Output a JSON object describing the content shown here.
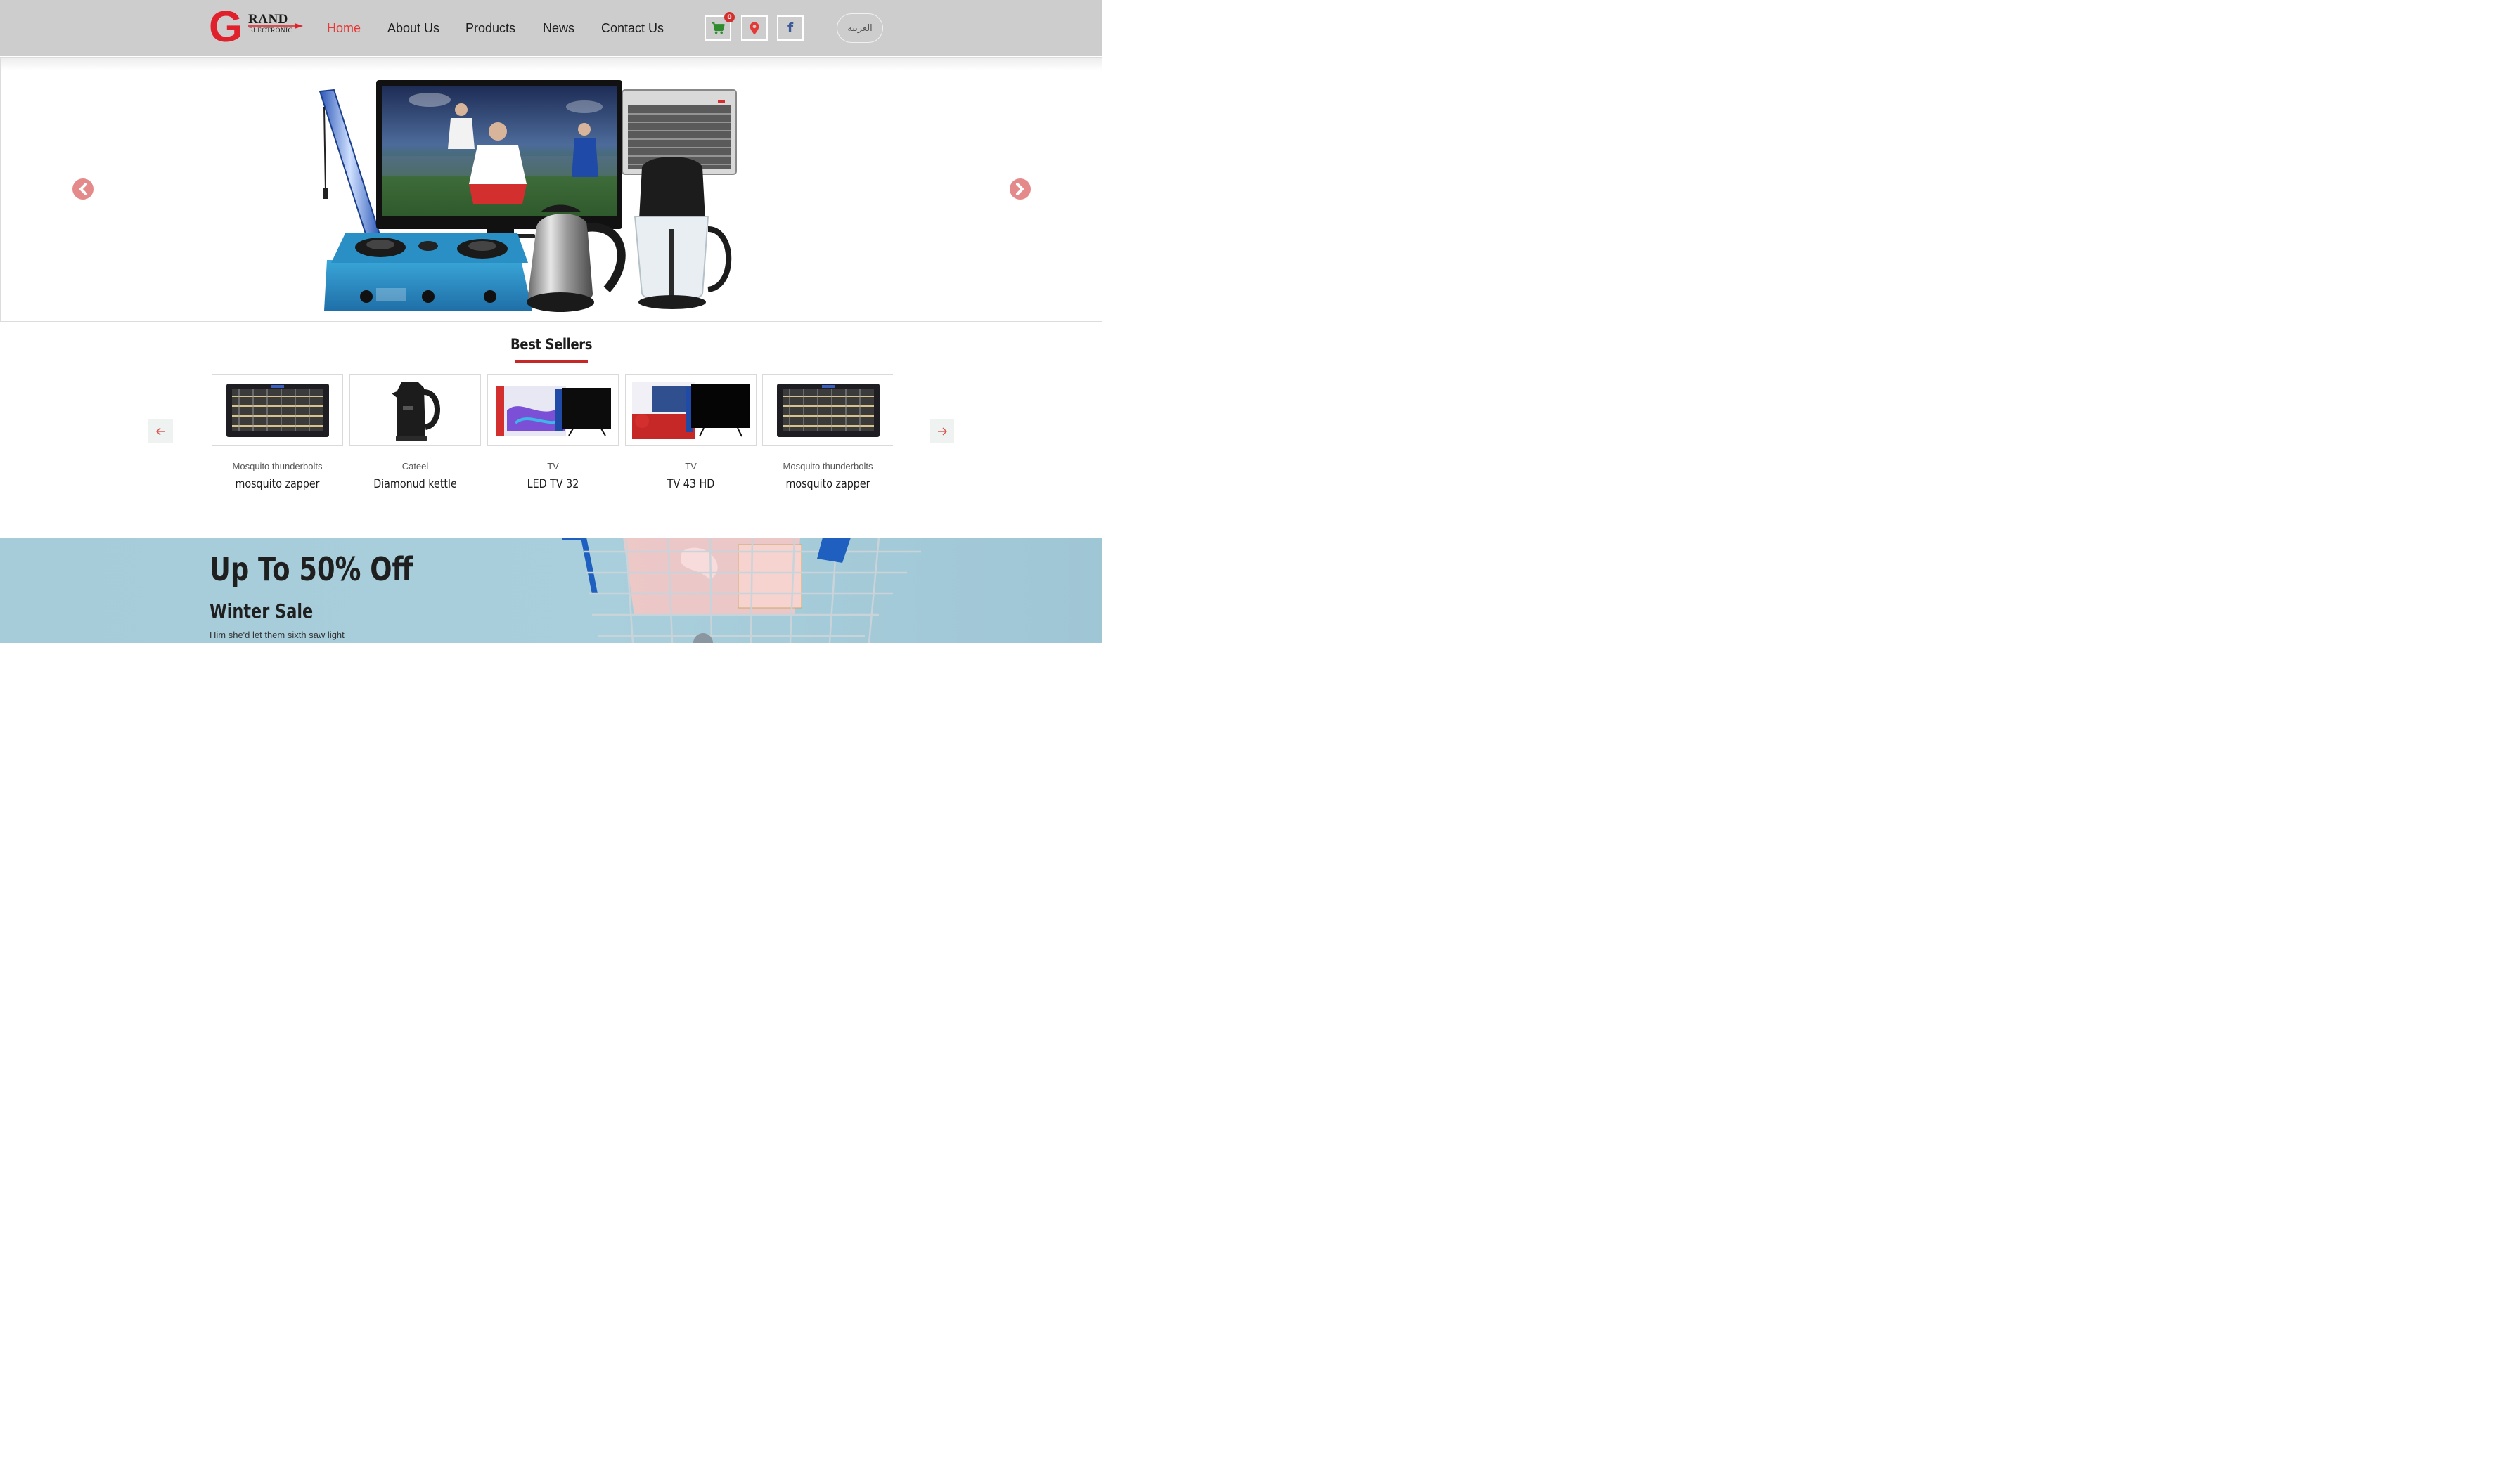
{
  "brand": {
    "logo_letter": "G",
    "logo_word": "RAND",
    "logo_tagline": "ELECTRONIC"
  },
  "nav": {
    "items": [
      {
        "label": "Home",
        "active": true
      },
      {
        "label": "About Us",
        "active": false
      },
      {
        "label": "Products",
        "active": false
      },
      {
        "label": "News",
        "active": false
      },
      {
        "label": "Contact Us",
        "active": false
      }
    ]
  },
  "header_icons": {
    "cart_icon": "shopping-cart-icon",
    "cart_count": "0",
    "location_icon": "map-pin-icon",
    "social_icon": "facebook-icon",
    "social_glyph": "f"
  },
  "language_button": {
    "label": "العربيه"
  },
  "hero": {
    "prev_icon": "chevron-left-icon",
    "next_icon": "chevron-right-icon"
  },
  "best_sellers": {
    "title": "Best Sellers",
    "prev_icon": "arrow-left-icon",
    "next_icon": "arrow-right-icon",
    "products": [
      {
        "category": "Mosquito thunderbolts",
        "name": "mosquito zapper",
        "image": "mosquito-zapper"
      },
      {
        "category": "Cateel",
        "name": "Diamonud kettle",
        "image": "kettle"
      },
      {
        "category": "TV",
        "name": "LED TV 32",
        "image": "tv-box"
      },
      {
        "category": "TV",
        "name": "TV 43 HD",
        "image": "tv-box"
      },
      {
        "category": "Mosquito thunderbolts",
        "name": "mosquito zapper",
        "image": "mosquito-zapper"
      }
    ]
  },
  "promo": {
    "headline": "Up To 50% Off",
    "subheading": "Winter Sale",
    "text": "Him she'd let them sixth saw light"
  },
  "colors": {
    "header_bg": "#cdcdcd",
    "accent_red": "#e53935",
    "cart_green": "#2e8b2e",
    "facebook_blue": "#3b5998",
    "promo_bg": "#a9cfdc"
  }
}
